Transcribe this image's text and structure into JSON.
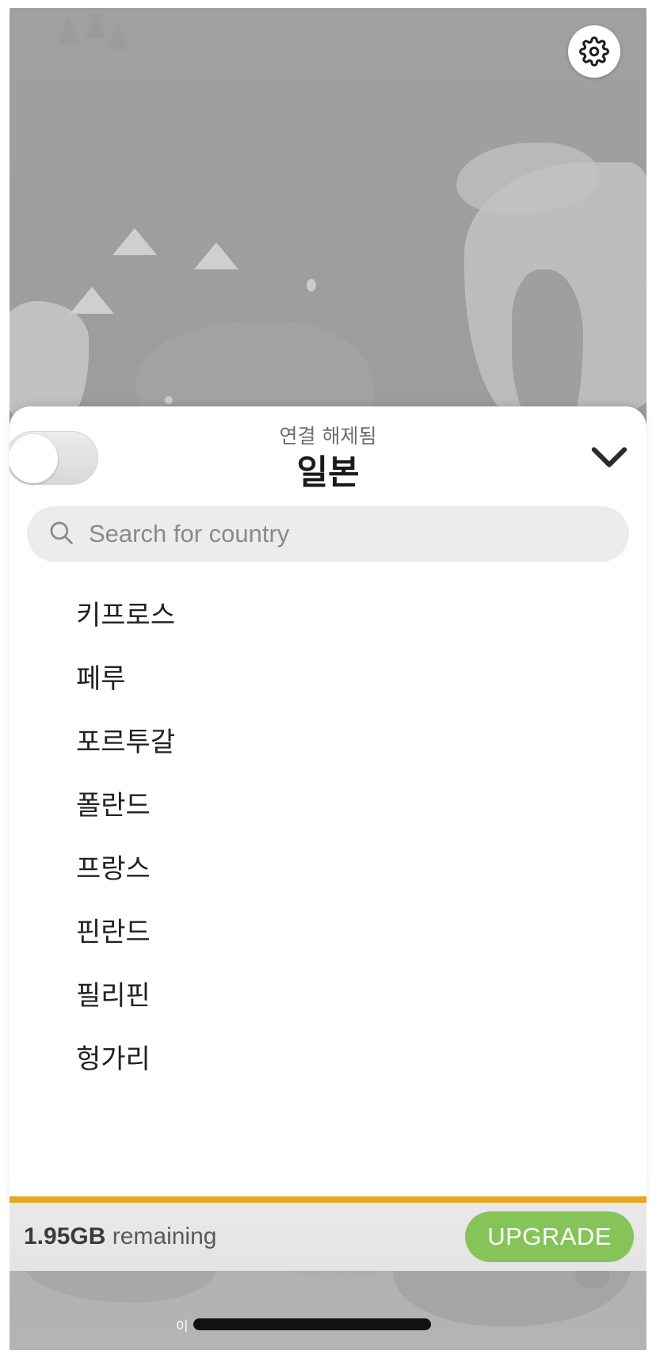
{
  "app": {
    "settings_icon": "gear-icon"
  },
  "map": {
    "marker_icon": "pot-marker-icon"
  },
  "sheet": {
    "connection_status": "연결 해제됨",
    "selected_country": "일본",
    "toggle_state": "off",
    "collapse_icon": "chevron-down-icon"
  },
  "search": {
    "icon": "search-icon",
    "placeholder": "Search for country",
    "value": ""
  },
  "countries": [
    {
      "name": "키프로스"
    },
    {
      "name": "페루"
    },
    {
      "name": "포르투갈"
    },
    {
      "name": "폴란드"
    },
    {
      "name": "프랑스"
    },
    {
      "name": "핀란드"
    },
    {
      "name": "필리핀"
    },
    {
      "name": "헝가리"
    }
  ],
  "data_bar": {
    "amount": "1.95GB",
    "remaining_label": " remaining",
    "upgrade_label": "UPGRADE",
    "progress_percent": 100,
    "progress_color": "#e8a71f",
    "upgrade_color": "#86c45a"
  },
  "system": {
    "home_indicator": "home-indicator"
  }
}
